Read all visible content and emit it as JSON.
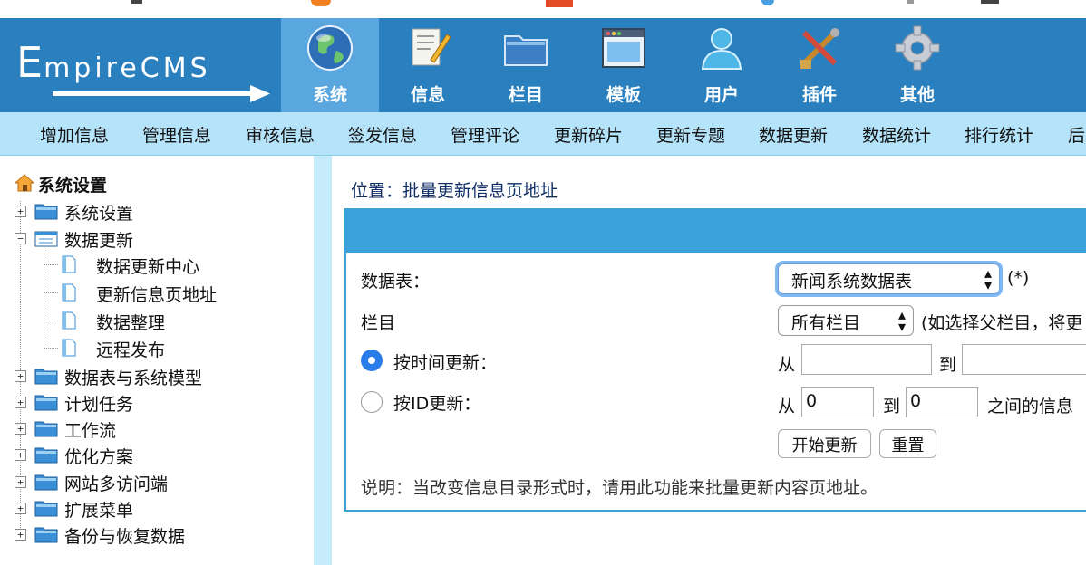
{
  "logo": {
    "text_big": "E",
    "text_small": "mpireCMS"
  },
  "nav": [
    {
      "label": "系统",
      "icon": "globe-icon"
    },
    {
      "label": "信息",
      "icon": "edit-document-icon"
    },
    {
      "label": "栏目",
      "icon": "folder-icon"
    },
    {
      "label": "模板",
      "icon": "window-template-icon"
    },
    {
      "label": "用户",
      "icon": "user-icon"
    },
    {
      "label": "插件",
      "icon": "tools-icon"
    },
    {
      "label": "其他",
      "icon": "gear-icon"
    }
  ],
  "subnav": [
    "增加信息",
    "管理信息",
    "审核信息",
    "签发信息",
    "管理评论",
    "更新碎片",
    "更新专题",
    "数据更新",
    "数据统计",
    "排行统计",
    "后"
  ],
  "sidebar": {
    "title": "系统设置",
    "nodes": [
      {
        "label": "系统设置"
      },
      {
        "label": "数据更新"
      },
      {
        "label": "数据更新中心"
      },
      {
        "label": "更新信息页地址"
      },
      {
        "label": "数据整理"
      },
      {
        "label": "远程发布"
      },
      {
        "label": "数据表与系统模型"
      },
      {
        "label": "计划任务"
      },
      {
        "label": "工作流"
      },
      {
        "label": "优化方案"
      },
      {
        "label": "网站多访问端"
      },
      {
        "label": "扩展菜单"
      },
      {
        "label": "备份与恢复数据"
      }
    ]
  },
  "breadcrumb": {
    "prefix": "位置：",
    "current": "批量更新信息页地址"
  },
  "form": {
    "table_label": "数据表：",
    "table_value": "新闻系统数据表",
    "table_required": "(*)",
    "column_label": "栏目",
    "column_value": "所有栏目",
    "column_hint": "(如选择父栏目，将更",
    "by_time_label": "按时间更新：",
    "by_id_label": "按ID更新：",
    "from_label": "从",
    "to_label": "到",
    "time_from": "",
    "time_to": "",
    "id_from": "0",
    "id_to": "0",
    "id_suffix": "之间的信息",
    "start_button": "开始更新",
    "reset_button": "重置",
    "note": "说明：当改变信息目录形式时，请用此功能来批量更新内容页地址。"
  },
  "colors": {
    "banner": "#2a80bf",
    "active_nav": "#5aa6de",
    "subnav": "#b4e3fa",
    "panel_border": "#3ba2d9"
  }
}
